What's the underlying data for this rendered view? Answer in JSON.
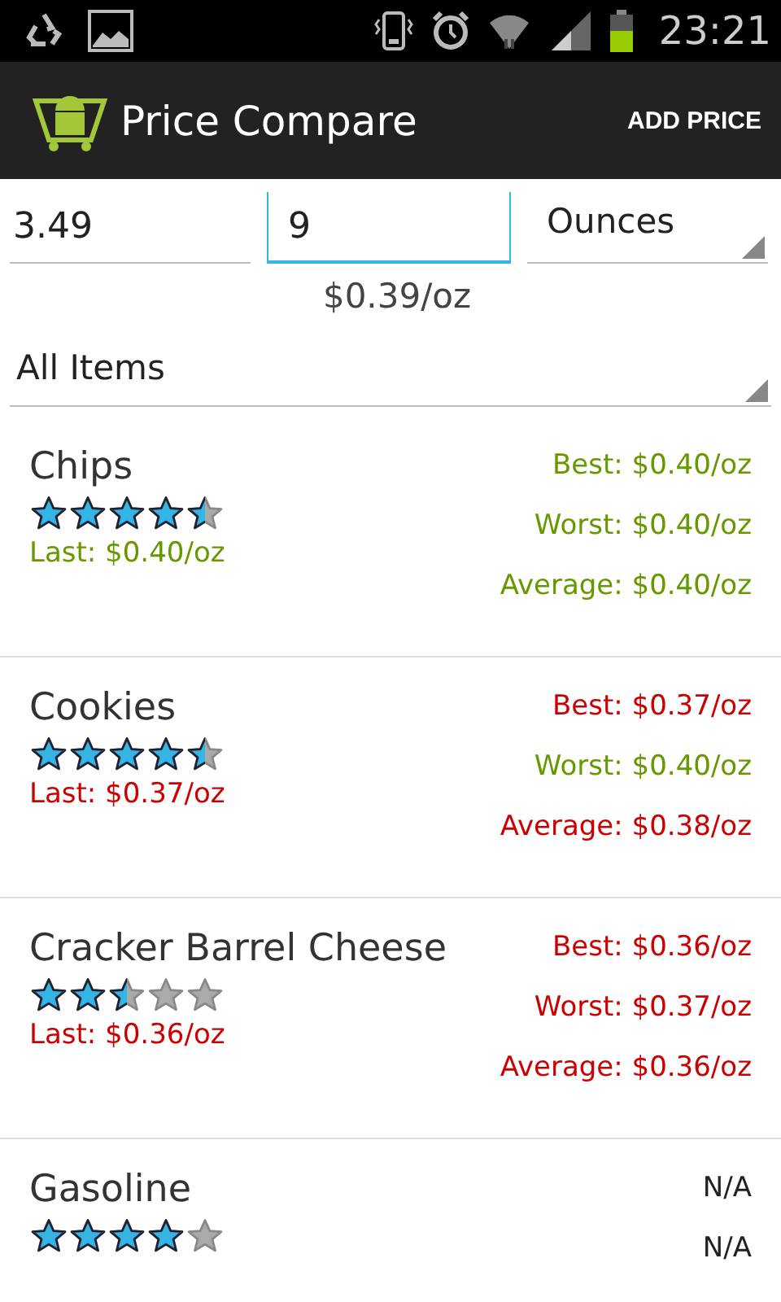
{
  "status_bar": {
    "time": "23:21"
  },
  "action_bar": {
    "title": "Price Compare",
    "action": "ADD PRICE"
  },
  "form": {
    "price": "3.49",
    "quantity": "9",
    "unit": "Ounces",
    "unit_price": "$0.39/oz",
    "category": "All Items"
  },
  "items": [
    {
      "name": "Chips",
      "stars": 4.5,
      "last": {
        "text": "Last: $0.40/oz",
        "color": "#669900"
      },
      "stats": [
        {
          "text": "Best: $0.40/oz",
          "color": "#669900"
        },
        {
          "text": "Worst: $0.40/oz",
          "color": "#669900"
        },
        {
          "text": "Average: $0.40/oz",
          "color": "#669900"
        }
      ]
    },
    {
      "name": "Cookies",
      "stars": 4.5,
      "last": {
        "text": "Last: $0.37/oz",
        "color": "#cc0000"
      },
      "stats": [
        {
          "text": "Best: $0.37/oz",
          "color": "#cc0000"
        },
        {
          "text": "Worst: $0.40/oz",
          "color": "#669900"
        },
        {
          "text": "Average: $0.38/oz",
          "color": "#cc0000"
        }
      ]
    },
    {
      "name": "Cracker Barrel Cheese",
      "stars": 2.5,
      "last": {
        "text": "Last: $0.36/oz",
        "color": "#cc0000"
      },
      "stats": [
        {
          "text": "Best: $0.36/oz",
          "color": "#cc0000"
        },
        {
          "text": "Worst: $0.37/oz",
          "color": "#cc0000"
        },
        {
          "text": "Average: $0.36/oz",
          "color": "#cc0000"
        }
      ]
    },
    {
      "name": "Gasoline",
      "stars": 4,
      "stats": [
        {
          "text": "N/A",
          "color": "#222222"
        },
        {
          "text": "N/A",
          "color": "#222222"
        }
      ]
    }
  ]
}
